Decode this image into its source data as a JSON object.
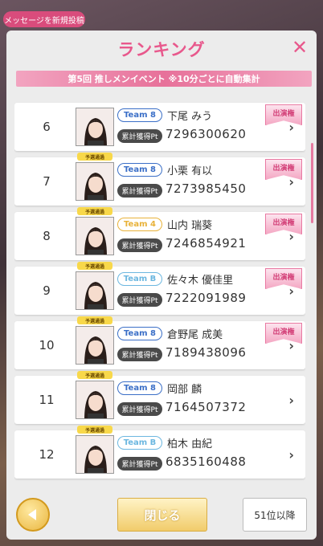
{
  "top_button": "メッセージを新規投稿",
  "modal": {
    "title": "ランキング",
    "close_icon": "close-icon",
    "subtitle": "第5回 推しメンイベント ※10分ごとに自動集計"
  },
  "pt_label": "累計獲得Pt",
  "yosen_label": "予選通過",
  "shuen_label": "出演権",
  "rows": [
    {
      "rank": "6",
      "team": "Team 8",
      "name": "下尾 みう",
      "points": "7296300620",
      "yosen": false,
      "shuen": true
    },
    {
      "rank": "7",
      "team": "Team 8",
      "name": "小栗 有以",
      "points": "7273985450",
      "yosen": true,
      "shuen": true
    },
    {
      "rank": "8",
      "team": "Team 4",
      "name": "山内 瑞葵",
      "points": "7246854921",
      "yosen": true,
      "shuen": true
    },
    {
      "rank": "9",
      "team": "Team B",
      "name": "佐々木 優佳里",
      "points": "7222091989",
      "yosen": true,
      "shuen": true
    },
    {
      "rank": "10",
      "team": "Team 8",
      "name": "倉野尾 成美",
      "points": "7189438096",
      "yosen": true,
      "shuen": true
    },
    {
      "rank": "11",
      "team": "Team 8",
      "name": "岡部 麟",
      "points": "7164507372",
      "yosen": true,
      "shuen": false
    },
    {
      "rank": "12",
      "team": "Team B",
      "name": "柏木 由紀",
      "points": "6835160488",
      "yosen": true,
      "shuen": false
    }
  ],
  "footer": {
    "back_icon": "back-arrow-icon",
    "close_label": "閉じる",
    "next_label": "51位以降"
  },
  "colors": {
    "accent": "#e8588c",
    "team8": "#3b6fc7",
    "team4": "#e8b23a",
    "teamB": "#6cb7e0"
  }
}
